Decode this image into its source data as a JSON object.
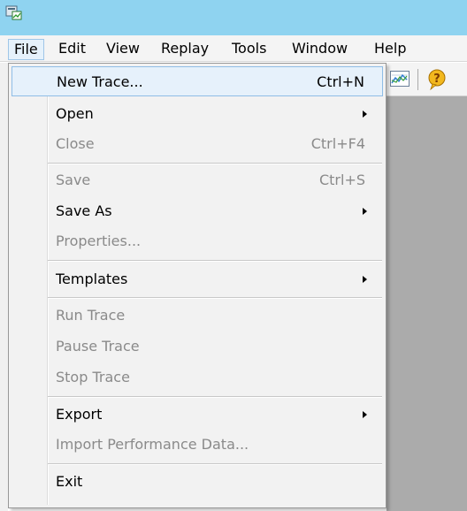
{
  "menubar": {
    "items": [
      "File",
      "Edit",
      "View",
      "Replay",
      "Tools",
      "Window",
      "Help"
    ]
  },
  "file_menu": {
    "items": [
      {
        "label": "New Trace...",
        "shortcut": "Ctrl+N",
        "enabled": true,
        "highlighted": true
      },
      {
        "label": "Open",
        "shortcut": "",
        "enabled": true,
        "submenu": true
      },
      {
        "label": "Close",
        "shortcut": "Ctrl+F4",
        "enabled": false
      },
      {
        "label": "Save",
        "shortcut": "Ctrl+S",
        "enabled": false
      },
      {
        "label": "Save As",
        "shortcut": "",
        "enabled": true,
        "submenu": true
      },
      {
        "label": "Properties...",
        "shortcut": "",
        "enabled": false
      },
      {
        "label": "Templates",
        "shortcut": "",
        "enabled": true,
        "submenu": true
      },
      {
        "label": "Run Trace",
        "shortcut": "",
        "enabled": false
      },
      {
        "label": "Pause Trace",
        "shortcut": "",
        "enabled": false
      },
      {
        "label": "Stop Trace",
        "shortcut": "",
        "enabled": false
      },
      {
        "label": "Export",
        "shortcut": "",
        "enabled": true,
        "submenu": true
      },
      {
        "label": "Import Performance Data...",
        "shortcut": "",
        "enabled": false
      },
      {
        "label": "Exit",
        "shortcut": "",
        "enabled": true
      }
    ]
  },
  "toolbar": {
    "icons": [
      "chart-icon",
      "help-icon"
    ]
  },
  "colors": {
    "titlebar": "#8fd3f0",
    "highlight": "#e6f1fb",
    "disabled_text": "#8a8a8a",
    "workspace": "#ababab"
  }
}
